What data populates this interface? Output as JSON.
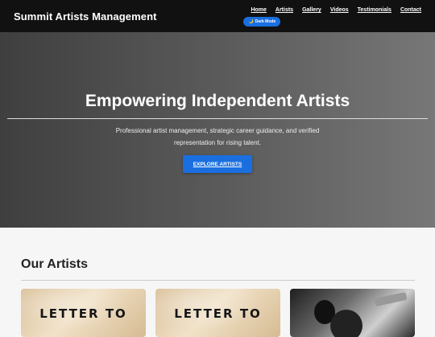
{
  "brand": "Summit Artists Management",
  "nav": {
    "links": [
      "Home",
      "Artists",
      "Gallery",
      "Videos",
      "Testimonials",
      "Contact"
    ],
    "dark_mode_label": "Dark Mode"
  },
  "hero": {
    "title": "Empowering Independent Artists",
    "subtitle": "Professional artist management, strategic career guidance, and verified representation for rising talent.",
    "cta_label": "EXPLORE ARTISTS"
  },
  "artists_section": {
    "title": "Our Artists",
    "cards": [
      {
        "cover_text": "LETTER TO"
      },
      {
        "cover_text": "LETTER TO"
      },
      {
        "cover_text": ""
      }
    ]
  },
  "colors": {
    "navbar": "#111111",
    "accent": "#1a6fe0"
  }
}
